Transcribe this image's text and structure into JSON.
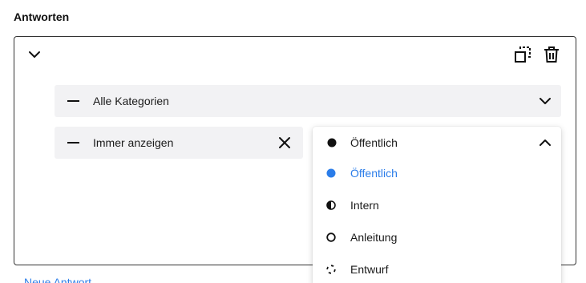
{
  "section": {
    "title": "Antworten"
  },
  "card": {
    "collapse_icon": "chevron-down-icon",
    "duplicate_icon": "duplicate-icon",
    "delete_icon": "trash-icon"
  },
  "rows": {
    "categories": {
      "label": "Alle Kategorien",
      "icon": "minus-icon",
      "toggle_icon": "chevron-down-icon"
    },
    "visibility": {
      "label": "Immer anzeigen",
      "icon": "minus-icon",
      "clear_icon": "close-icon"
    }
  },
  "status_select": {
    "selected_label": "Öffentlich",
    "selected_icon": "filled-circle-icon",
    "toggle_icon": "chevron-up-icon",
    "options": [
      {
        "label": "Öffentlich",
        "icon": "filled-circle-icon",
        "selected": true
      },
      {
        "label": "Intern",
        "icon": "half-circle-icon",
        "selected": false
      },
      {
        "label": "Anleitung",
        "icon": "ring-icon",
        "selected": false
      },
      {
        "label": "Entwurf",
        "icon": "dashed-circle-icon",
        "selected": false
      }
    ]
  },
  "footer": {
    "add_link_label": "Neue Antwort"
  },
  "colors": {
    "accent": "#2b7de9",
    "row_bg": "#f2f2f4",
    "text": "#1a1a1a"
  }
}
